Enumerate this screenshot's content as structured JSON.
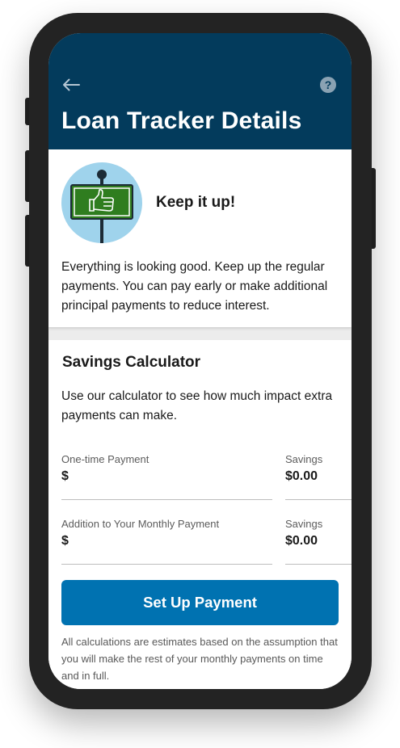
{
  "header": {
    "title": "Loan Tracker Details",
    "back_icon": "arrow-left-icon",
    "help_icon": "question-mark-icon",
    "help_glyph": "?",
    "background_color": "#033b5c"
  },
  "status_card": {
    "illustration_icon": "thumbs-up-sign-icon",
    "heading": "Keep it up!",
    "body": "Everything is looking good. Keep up the regular payments. You can pay early or make additional principal payments to reduce interest."
  },
  "calculator": {
    "title": "Savings Calculator",
    "description": "Use our calculator to see how much impact extra payments can make.",
    "fields": [
      {
        "label": "One-time Payment",
        "value": "$",
        "savings_label": "Savings",
        "savings_value": "$0.00"
      },
      {
        "label": "Addition to Your Monthly Payment",
        "value": "$",
        "savings_label": "Savings",
        "savings_value": "$0.00"
      }
    ],
    "cta_label": "Set Up Payment",
    "cta_color": "#0072b1",
    "disclaimer": "All calculations are estimates based on the assumption that you will make the rest of your monthly payments on time and in full."
  }
}
